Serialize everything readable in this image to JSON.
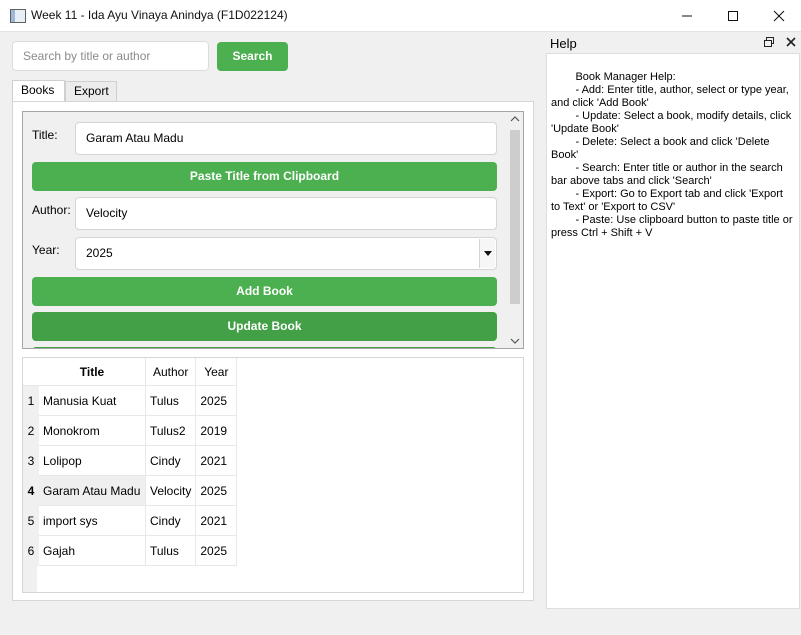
{
  "window": {
    "title": "Week 11 - Ida Ayu Vinaya Anindya (F1D022124)"
  },
  "search": {
    "placeholder": "Search by title or author",
    "button_label": "Search"
  },
  "tabs": [
    {
      "label": "Books",
      "active": true
    },
    {
      "label": "Export",
      "active": false
    }
  ],
  "form": {
    "title_label": "Title:",
    "title_value": "Garam Atau Madu",
    "paste_button": "Paste Title from Clipboard",
    "author_label": "Author:",
    "author_value": "Velocity",
    "year_label": "Year:",
    "year_value": "2025",
    "add_button": "Add Book",
    "update_button": "Update Book"
  },
  "table": {
    "headers": [
      "Title",
      "Author",
      "Year"
    ],
    "rows": [
      {
        "num": "1",
        "title": "Manusia Kuat",
        "author": "Tulus",
        "year": "2025"
      },
      {
        "num": "2",
        "title": "Monokrom",
        "author": "Tulus2",
        "year": "2019"
      },
      {
        "num": "3",
        "title": "Lolipop",
        "author": "Cindy",
        "year": "2021"
      },
      {
        "num": "4",
        "title": "Garam Atau Madu",
        "author": "Velocity",
        "year": "2025"
      },
      {
        "num": "5",
        "title": "import sys",
        "author": "Cindy",
        "year": "2021"
      },
      {
        "num": "6",
        "title": "Gajah",
        "author": "Tulus",
        "year": "2025"
      }
    ]
  },
  "help": {
    "title": "Help",
    "text": "        Book Manager Help:\n        - Add: Enter title, author, select or type year, and click 'Add Book'\n        - Update: Select a book, modify details, click 'Update Book'\n        - Delete: Select a book and click 'Delete Book'\n        - Search: Enter title or author in the search bar above tabs and click 'Search'\n        - Export: Go to Export tab and click 'Export to Text' or 'Export to CSV'\n        - Paste: Use clipboard button to paste title or press Ctrl + Shift + V"
  },
  "colors": {
    "accent_green": "#4caf50",
    "accent_green_dark": "#43a047"
  }
}
